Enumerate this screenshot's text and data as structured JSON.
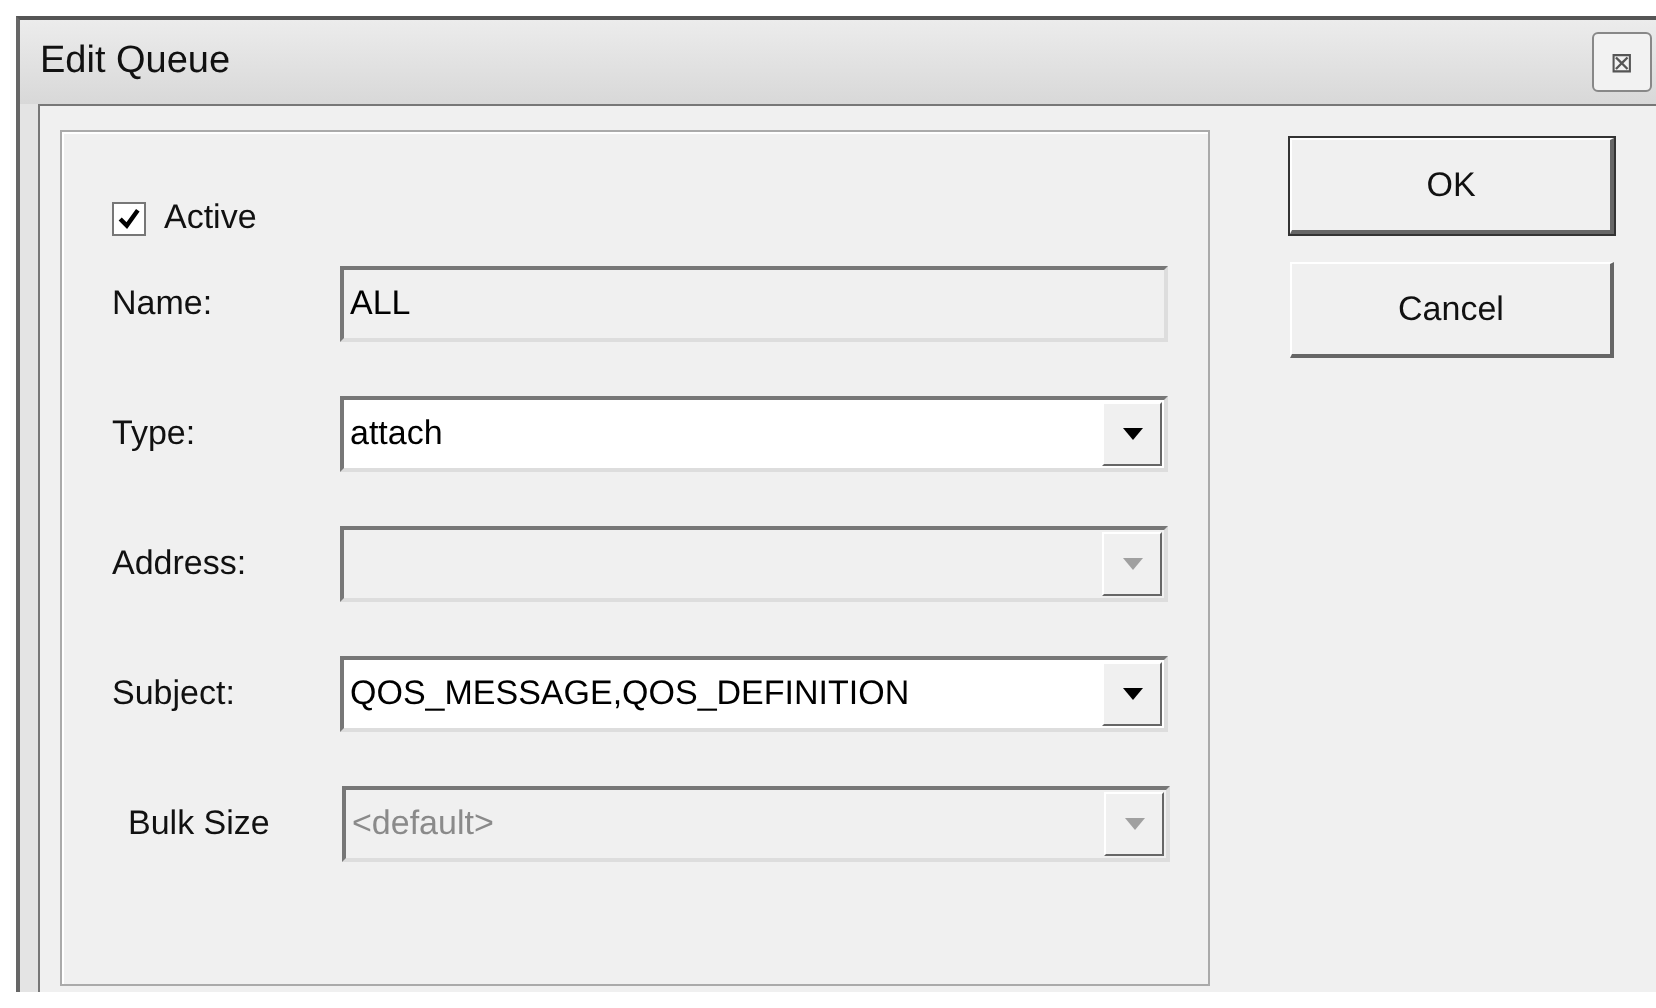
{
  "window": {
    "title": "Edit Queue",
    "close": "⊠"
  },
  "active": {
    "label": "Active",
    "checked": true
  },
  "fields": [
    {
      "label": "Name:",
      "kind": "text",
      "value": "ALL",
      "disabled": true
    },
    {
      "label": "Type:",
      "kind": "combo",
      "value": "attach",
      "disabled": false
    },
    {
      "label": "Address:",
      "kind": "combo",
      "disabled": true
    },
    {
      "label": "Subject:",
      "kind": "combo",
      "value": "QOS_MESSAGE,QOS_DEFINITION",
      "disabled": false
    },
    {
      "label": "Bulk Size",
      "kind": "combo",
      "placeholder": "<default>",
      "disabled": true
    }
  ],
  "buttons": [
    {
      "label": "OK",
      "default": true
    },
    {
      "label": "Cancel",
      "default": false
    }
  ]
}
